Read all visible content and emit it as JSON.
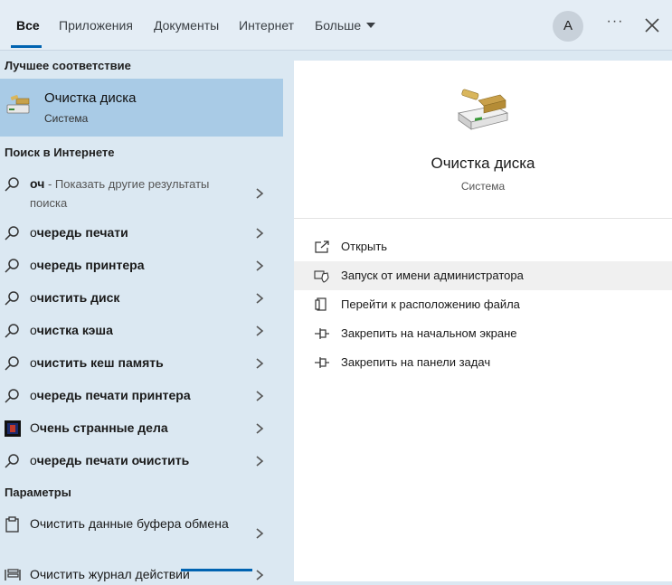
{
  "tabs": [
    {
      "label": "Все",
      "active": true
    },
    {
      "label": "Приложения"
    },
    {
      "label": "Документы"
    },
    {
      "label": "Интернет"
    },
    {
      "label": "Больше"
    }
  ],
  "account_initial": "A",
  "more_symbol": "···",
  "best_match": {
    "section_title": "Лучшее соответствие",
    "name": "Очистка диска",
    "subtitle": "Система",
    "icon": "disk-cleanup-icon"
  },
  "web_search": {
    "section_title": "Поиск в Интернете",
    "first": {
      "query": "оч",
      "hint": " - Показать другие результаты поиска"
    },
    "items": [
      {
        "prefix": "о",
        "rest": "чередь печати"
      },
      {
        "prefix": "о",
        "rest": "чередь принтера"
      },
      {
        "prefix": "о",
        "rest": "чистить диск"
      },
      {
        "prefix": "о",
        "rest": "чистка кэша"
      },
      {
        "prefix": "о",
        "rest": "чистить кеш память"
      },
      {
        "prefix": "о",
        "rest": "чередь печати принтера"
      },
      {
        "prefix": "О",
        "rest": "чень странные дела",
        "icon": "stranger-things-icon"
      },
      {
        "prefix": "о",
        "rest": "чередь печати очистить"
      }
    ]
  },
  "settings": {
    "section_title": "Параметры",
    "items": [
      {
        "label": "Очистить данные буфера обмена",
        "icon": "clipboard-icon"
      },
      {
        "label": "Очистить журнал действий",
        "icon": "activity-history-icon"
      }
    ]
  },
  "detail": {
    "name": "Очистка диска",
    "subtitle": "Система",
    "actions": [
      {
        "label": "Открыть",
        "icon": "open-icon"
      },
      {
        "label": "Запуск от имени администратора",
        "icon": "shield-icon"
      },
      {
        "label": "Перейти к расположению файла",
        "icon": "file-location-icon"
      },
      {
        "label": "Закрепить на начальном экране",
        "icon": "pin-icon"
      },
      {
        "label": "Закрепить на панели задач",
        "icon": "pin-icon"
      }
    ]
  },
  "colors": {
    "accent": "#0063b1",
    "selected_bg": "#a9cbe6",
    "pane_bg": "#dbe8f2"
  }
}
